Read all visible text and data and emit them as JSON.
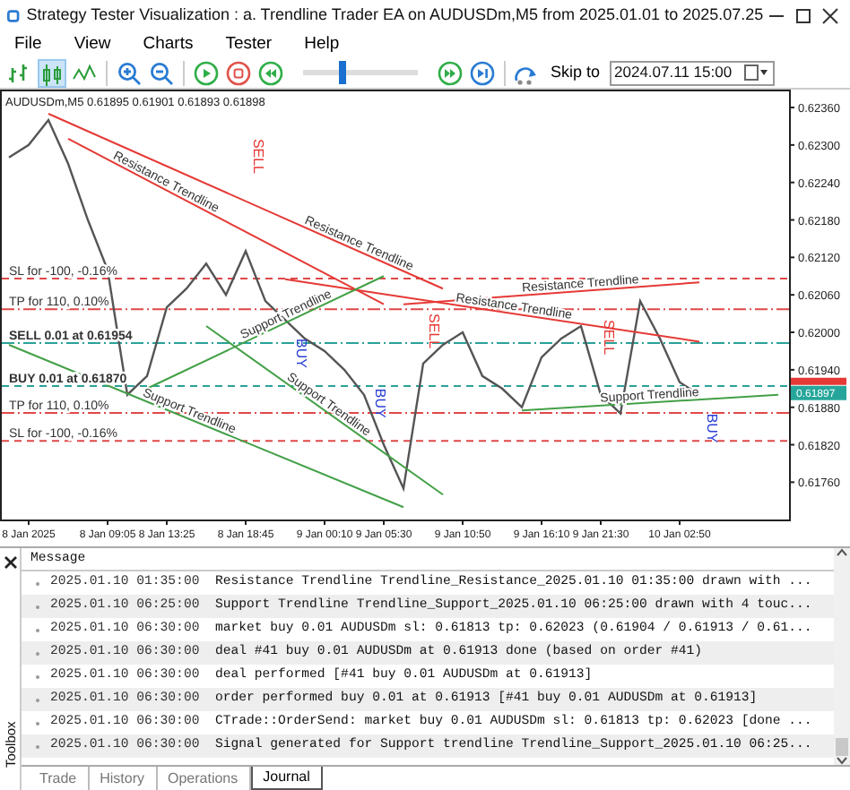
{
  "window": {
    "title": "Strategy Tester Visualization : a. Trendline Trader EA on AUDUSDm,M5 from 2025.01.01 to 2025.07.25"
  },
  "menu": [
    "File",
    "View",
    "Charts",
    "Tester",
    "Help"
  ],
  "toolbar": {
    "chart_types": [
      {
        "kind": "bars",
        "selected": false
      },
      {
        "kind": "candles",
        "selected": true
      },
      {
        "kind": "line",
        "selected": false
      }
    ],
    "speed": {
      "level": 0.35
    },
    "skip_label": "Skip to",
    "skip_date": "2024.07.11 15:00"
  },
  "chart": {
    "header": "AUDUSDm,M5  0.61895 0.61901 0.61893 0.61898",
    "chart_data": {
      "type": "line",
      "categories": [
        null,
        "8 Jan 2025",
        null,
        null,
        null,
        "8 Jan 09:05",
        null,
        null,
        "8 Jan 13:25",
        null,
        null,
        null,
        "8 Jan 18:45",
        null,
        null,
        null,
        "9 Jan 00:10",
        null,
        null,
        "9 Jan 05:30",
        null,
        null,
        null,
        "9 Jan 10:50",
        null,
        null,
        null,
        "9 Jan 16:10",
        null,
        null,
        "9 Jan 21:30",
        null,
        null,
        null,
        "10 Jan 02:50",
        null,
        null,
        null,
        null,
        null
      ],
      "series": [
        {
          "color": "#555555",
          "values": [
            0.6228,
            0.623,
            0.6234,
            0.6227,
            0.6218,
            0.621,
            0.619,
            0.6193,
            0.6204,
            0.6207,
            0.6211,
            0.6206,
            0.6213,
            0.6205,
            0.6202,
            0.6199,
            0.6197,
            0.6194,
            0.619,
            0.6182,
            0.6175,
            0.6195,
            0.6198,
            0.62,
            0.6193,
            0.6191,
            0.6188,
            0.6196,
            0.6199,
            0.6201,
            0.619,
            0.6187,
            0.6205,
            0.6199,
            0.6192,
            0.619,
            null,
            null,
            null,
            null
          ]
        },
        {
          "name": "Resistance Trendline",
          "color": "#e53935",
          "values": [
            null,
            null,
            0.6235,
            null,
            null,
            null,
            null,
            null,
            null,
            null,
            null,
            null,
            null,
            null,
            null,
            null,
            null,
            null,
            null,
            null,
            null,
            null,
            0.6207,
            null,
            null,
            null,
            null,
            null,
            null,
            null,
            null,
            null,
            null,
            null,
            null,
            null,
            null,
            null,
            null,
            null
          ]
        },
        {
          "name": "Resistance Trendline",
          "color": "#e53935",
          "values": [
            null,
            null,
            null,
            0.6231,
            null,
            null,
            null,
            null,
            null,
            null,
            null,
            null,
            null,
            null,
            null,
            null,
            null,
            null,
            null,
            0.62045,
            null,
            null,
            null,
            null,
            null,
            null,
            null,
            null,
            null,
            null,
            null,
            null,
            null,
            null,
            null,
            null,
            null,
            null,
            null,
            null
          ]
        },
        {
          "name": "Resistance Trendline",
          "color": "#e53935",
          "values": [
            null,
            null,
            null,
            null,
            null,
            null,
            null,
            null,
            null,
            null,
            null,
            null,
            null,
            null,
            0.62085,
            null,
            null,
            null,
            null,
            null,
            null,
            null,
            null,
            null,
            null,
            null,
            null,
            null,
            null,
            null,
            null,
            null,
            null,
            null,
            null,
            0.61985,
            null,
            null,
            null,
            null
          ]
        },
        {
          "name": "Resistance Trendline",
          "color": "#e53935",
          "values": [
            null,
            null,
            null,
            null,
            null,
            null,
            null,
            null,
            null,
            null,
            null,
            null,
            null,
            null,
            null,
            null,
            null,
            null,
            null,
            null,
            0.62045,
            null,
            null,
            null,
            null,
            null,
            null,
            null,
            null,
            null,
            null,
            null,
            null,
            null,
            null,
            0.6208,
            null,
            null,
            null,
            null
          ]
        },
        {
          "name": "Support Trendline",
          "color": "#43a047",
          "values": [
            0.6198,
            null,
            null,
            null,
            null,
            null,
            null,
            null,
            null,
            null,
            null,
            null,
            null,
            null,
            null,
            null,
            null,
            null,
            null,
            null,
            0.6172,
            null,
            null,
            null,
            null,
            null,
            null,
            null,
            null,
            null,
            null,
            null,
            null,
            null,
            null,
            null,
            null,
            null,
            null,
            null
          ]
        },
        {
          "name": "Support Trendline",
          "color": "#43a047",
          "values": [
            null,
            null,
            null,
            null,
            null,
            null,
            null,
            0.6191,
            null,
            null,
            null,
            null,
            null,
            null,
            null,
            null,
            null,
            null,
            null,
            0.6209,
            null,
            null,
            null,
            null,
            null,
            null,
            null,
            null,
            null,
            null,
            null,
            null,
            null,
            null,
            null,
            null,
            null,
            null,
            null,
            null
          ]
        },
        {
          "name": "Support Trendline",
          "color": "#43a047",
          "values": [
            null,
            null,
            null,
            null,
            null,
            null,
            null,
            null,
            null,
            null,
            0.6201,
            null,
            null,
            null,
            null,
            null,
            null,
            null,
            null,
            null,
            null,
            null,
            0.6174,
            null,
            null,
            null,
            null,
            null,
            null,
            null,
            null,
            null,
            null,
            null,
            null,
            null,
            null,
            null,
            null,
            null
          ]
        },
        {
          "name": "Support Trendline",
          "color": "#43a047",
          "values": [
            null,
            null,
            null,
            null,
            null,
            null,
            null,
            null,
            null,
            null,
            null,
            null,
            null,
            null,
            null,
            null,
            null,
            null,
            null,
            null,
            null,
            null,
            null,
            null,
            null,
            null,
            0.61875,
            null,
            null,
            null,
            null,
            null,
            null,
            null,
            null,
            null,
            null,
            null,
            null,
            0.619
          ]
        }
      ],
      "ylim": [
        0.61706,
        0.62383
      ],
      "yticks": [
        {
          "value": 0.6236,
          "label": "0.62360"
        },
        {
          "value": 0.623,
          "label": "0.62300"
        },
        {
          "value": 0.6224,
          "label": "0.62240"
        },
        {
          "value": 0.6218,
          "label": "0.62180"
        },
        {
          "value": 0.6212,
          "label": "0.62120"
        },
        {
          "value": 0.6206,
          "label": "0.62060"
        },
        {
          "value": 0.62,
          "label": "0.62000"
        },
        {
          "value": 0.6194,
          "label": "0.61940"
        },
        {
          "value": 0.6188,
          "label": "0.61880"
        },
        {
          "value": 0.6182,
          "label": "0.61820"
        },
        {
          "value": 0.6176,
          "label": "0.61760"
        }
      ],
      "ref_lines": [
        {
          "axis": "y",
          "value": 0.62086,
          "label": "SL for -100, -0.16%",
          "color": "#e04848"
        },
        {
          "axis": "y",
          "value": 0.62037,
          "label": "TP for 110, 0.10%",
          "color": "#e04848"
        },
        {
          "axis": "y",
          "value": 0.61983,
          "label": "SELL 0.01 at 0.61954",
          "color": "#2aa198"
        },
        {
          "axis": "y",
          "value": 0.61914,
          "label": "BUY 0.01 at 0.61870",
          "color": "#2aa198"
        },
        {
          "axis": "y",
          "value": 0.61871,
          "label": "TP for 110, 0.10%",
          "color": "#e04848"
        },
        {
          "axis": "y",
          "value": 0.61826,
          "label": "SL for -100, -0.16%",
          "color": "#e04848"
        }
      ]
    },
    "signals": [
      {
        "kind": "sell",
        "label": "SELL"
      },
      {
        "kind": "sell",
        "label": "SELL"
      },
      {
        "kind": "sell",
        "label": "SELL"
      },
      {
        "kind": "buy",
        "label": "BUY"
      },
      {
        "kind": "buy",
        "label": "BUY"
      },
      {
        "kind": "buy",
        "label": "BUY"
      }
    ],
    "price_tag": {
      "text": "0.61897"
    }
  },
  "journal": {
    "header": "Message",
    "rows": [
      {
        "time": "2025.01.10 01:35:00",
        "message": "Resistance Trendline Trendline_Resistance_2025.01.10 01:35:00 drawn with ..."
      },
      {
        "time": "2025.01.10 06:25:00",
        "message": "Support Trendline Trendline_Support_2025.01.10 06:25:00 drawn with 4 touc..."
      },
      {
        "time": "2025.01.10 06:30:00",
        "message": "market buy 0.01 AUDUSDm sl: 0.61813 tp: 0.62023 (0.61904 / 0.61913 / 0.61..."
      },
      {
        "time": "2025.01.10 06:30:00",
        "message": "deal #41 buy 0.01 AUDUSDm at 0.61913 done (based on order #41)"
      },
      {
        "time": "2025.01.10 06:30:00",
        "message": "deal performed [#41 buy 0.01 AUDUSDm at 0.61913]"
      },
      {
        "time": "2025.01.10 06:30:00",
        "message": "order performed buy 0.01 at 0.61913 [#41 buy 0.01 AUDUSDm at 0.61913]"
      },
      {
        "time": "2025.01.10 06:30:00",
        "message": "CTrade::OrderSend: market buy 0.01 AUDUSDm sl: 0.61813 tp: 0.62023 [done ..."
      },
      {
        "time": "2025.01.10 06:30:00",
        "message": "Signal generated for Support trendline Trendline_Support_2025.01.10 06:25..."
      }
    ],
    "side_label": "Toolbox",
    "tabs": [
      {
        "label": "Trade",
        "selected": false
      },
      {
        "label": "History",
        "selected": false
      },
      {
        "label": "Operations",
        "selected": false
      },
      {
        "label": "Journal",
        "selected": true
      }
    ]
  }
}
